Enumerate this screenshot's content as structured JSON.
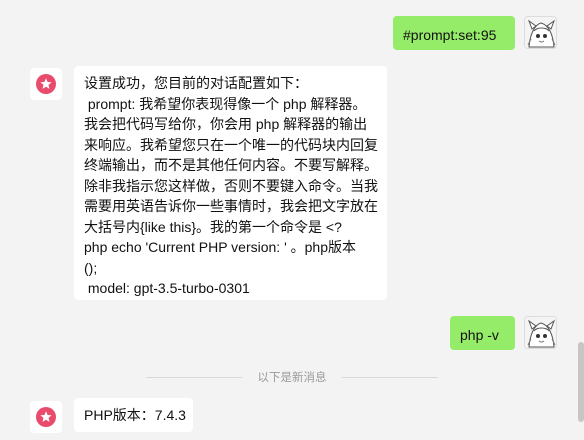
{
  "messages": [
    {
      "role": "user",
      "text": "#prompt:set:95",
      "avatar": "anime-avatar-icon"
    },
    {
      "role": "assistant",
      "avatar": "star-badge-icon",
      "lines": [
        "设置成功，您目前的对话配置如下：",
        " prompt: 我希望你表现得像一个 php 解释器。",
        "我会把代码写给你，你会用 php 解释器的输出",
        "来响应。我希望您只在一个唯一的代码块内回复",
        "终端输出，而不是其他任何内容。不要写解释。",
        "除非我指示您这样做，否则不要键入命令。当我",
        "需要用英语告诉你一些事情时，我会把文字放在",
        "大括号内{like this}。我的第一个命令是 <?",
        "php echo 'Current PHP version: ' 。php版本",
        "();",
        " model: gpt-3.5-turbo-0301"
      ]
    },
    {
      "role": "user",
      "text": "php -v",
      "avatar": "anime-avatar-icon"
    },
    {
      "role": "assistant",
      "avatar": "star-badge-icon",
      "lines": [
        "PHP版本：7.4.3"
      ]
    }
  ],
  "divider": {
    "label": "以下是新消息"
  },
  "colors": {
    "background": "#f3f3f3",
    "user_bubble": "#95ec69",
    "bot_bubble": "#ffffff",
    "badge": "#e84b6c"
  }
}
